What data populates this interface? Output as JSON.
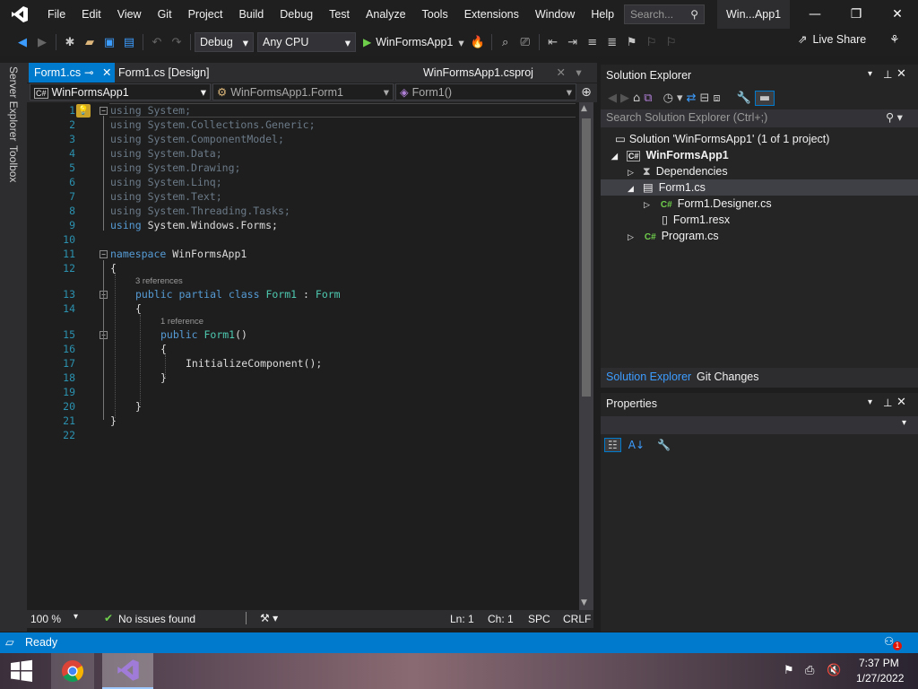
{
  "menu": [
    "File",
    "Edit",
    "View",
    "Git",
    "Project",
    "Build",
    "Debug",
    "Test",
    "Analyze",
    "Tools",
    "Extensions",
    "Window",
    "Help"
  ],
  "search": {
    "placeholder": "Search..."
  },
  "window_title": "Win...App1",
  "toolbar": {
    "config": "Debug",
    "platform": "Any CPU",
    "run_label": "WinFormsApp1",
    "live_share": "Live Share"
  },
  "rail": {
    "server_explorer": "Server Explorer",
    "toolbox": "Toolbox"
  },
  "tabs": {
    "form1": "Form1.cs",
    "design": "Form1.cs [Design]",
    "csproj": "WinFormsApp1.csproj"
  },
  "nav": {
    "project": "WinFormsApp1",
    "class": "WinFormsApp1.Form1",
    "member": "Form1()"
  },
  "code": {
    "l1": "System;",
    "l2": "System.Collections.Generic;",
    "l3": "System.ComponentModel;",
    "l4": "System.Data;",
    "l5": "System.Drawing;",
    "l6": "System.Linq;",
    "l7": "System.Text;",
    "l8": "System.Threading.Tasks;",
    "l9": "System.Windows.Forms;",
    "using": "using",
    "namespace": "namespace",
    "ns_name": "WinFormsApp1",
    "public": "public",
    "partial": "partial",
    "class": "class",
    "form1": "Form1",
    "colon": ":",
    "form": "Form",
    "ctor": "Form1",
    "parens": "()",
    "init": "InitializeComponent();",
    "open": "{",
    "close": "}",
    "refs3": "3 references",
    "refs1": "1 reference"
  },
  "line_numbers": [
    "1",
    "2",
    "3",
    "4",
    "5",
    "6",
    "7",
    "8",
    "9",
    "10",
    "11",
    "12",
    "13",
    "14",
    "15",
    "16",
    "17",
    "18",
    "19",
    "20",
    "21",
    "22"
  ],
  "editor_status": {
    "zoom": "100 %",
    "issues": "No issues found",
    "ln": "Ln: 1",
    "ch": "Ch: 1",
    "spc": "SPC",
    "crlf": "CRLF"
  },
  "solution_explorer": {
    "title": "Solution Explorer",
    "search_placeholder": "Search Solution Explorer (Ctrl+;)",
    "solution": "Solution 'WinFormsApp1' (1 of 1 project)",
    "project": "WinFormsApp1",
    "dependencies": "Dependencies",
    "form1": "Form1.cs",
    "designer": "Form1.Designer.cs",
    "resx": "Form1.resx",
    "program": "Program.cs",
    "tab_se": "Solution Explorer",
    "tab_git": "Git Changes"
  },
  "properties": {
    "title": "Properties"
  },
  "status": {
    "ready": "Ready",
    "notif_count": "1"
  },
  "taskbar": {
    "time": "7:37 PM",
    "date": "1/27/2022"
  },
  "colors": {
    "accent": "#007acc",
    "keyword": "#569cd6",
    "type": "#4ec9b0",
    "line_number": "#2b91af"
  }
}
